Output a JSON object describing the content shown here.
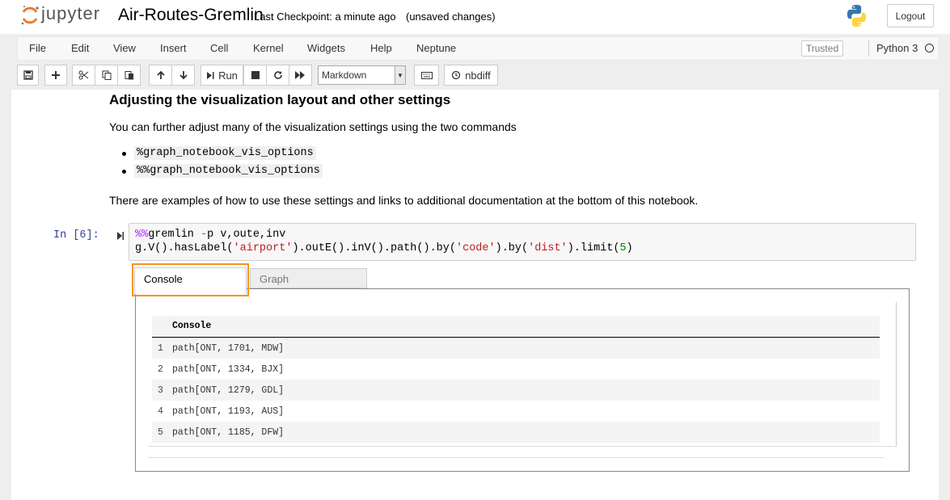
{
  "header": {
    "logo_text": "jupyter",
    "notebook_title": "Air-Routes-Gremlin",
    "checkpoint": "Last Checkpoint: a minute ago",
    "unsaved": "(unsaved changes)",
    "logout_label": "Logout"
  },
  "menubar": {
    "items": [
      "File",
      "Edit",
      "View",
      "Insert",
      "Cell",
      "Kernel",
      "Widgets",
      "Help",
      "Neptune"
    ],
    "trusted_label": "Trusted",
    "kernel_name": "Python 3"
  },
  "toolbar": {
    "run_label": "Run",
    "cell_type": "Markdown",
    "nbdiff_label": "nbdiff"
  },
  "markdown": {
    "heading": "Adjusting the visualization layout and other settings",
    "intro": "You can further adjust many of the visualization settings using the two commands",
    "bullets": [
      "%graph_notebook_vis_options",
      "%%graph_notebook_vis_options"
    ],
    "outro": "There are examples of how to use these settings and links to additional documentation at the bottom of this notebook."
  },
  "code_cell": {
    "prompt": "In [6]:",
    "line1": {
      "magic": "%%",
      "cmd": "gremlin ",
      "op": "-",
      "rest": "p v,oute,inv"
    },
    "line2": {
      "p1": "g.V().hasLabel(",
      "s1": "'airport'",
      "p2": ").outE().inV().path().by(",
      "s2": "'code'",
      "p3": ").by(",
      "s3": "'dist'",
      "p4": ").limit(",
      "n1": "5",
      "p5": ")"
    }
  },
  "output": {
    "tabs": [
      "Console",
      "Graph"
    ],
    "table_header": "Console",
    "rows": [
      {
        "idx": "1",
        "value": "path[ONT, 1701, MDW]"
      },
      {
        "idx": "2",
        "value": "path[ONT, 1334, BJX]"
      },
      {
        "idx": "3",
        "value": "path[ONT, 1279, GDL]"
      },
      {
        "idx": "4",
        "value": "path[ONT, 1193, AUS]"
      },
      {
        "idx": "5",
        "value": "path[ONT, 1185, DFW]"
      }
    ]
  },
  "colors": {
    "logo_orange": "#f37726",
    "highlight": "#f7941d",
    "prompt_blue": "#303f9f",
    "row_stripe": "#f4f4f4"
  }
}
